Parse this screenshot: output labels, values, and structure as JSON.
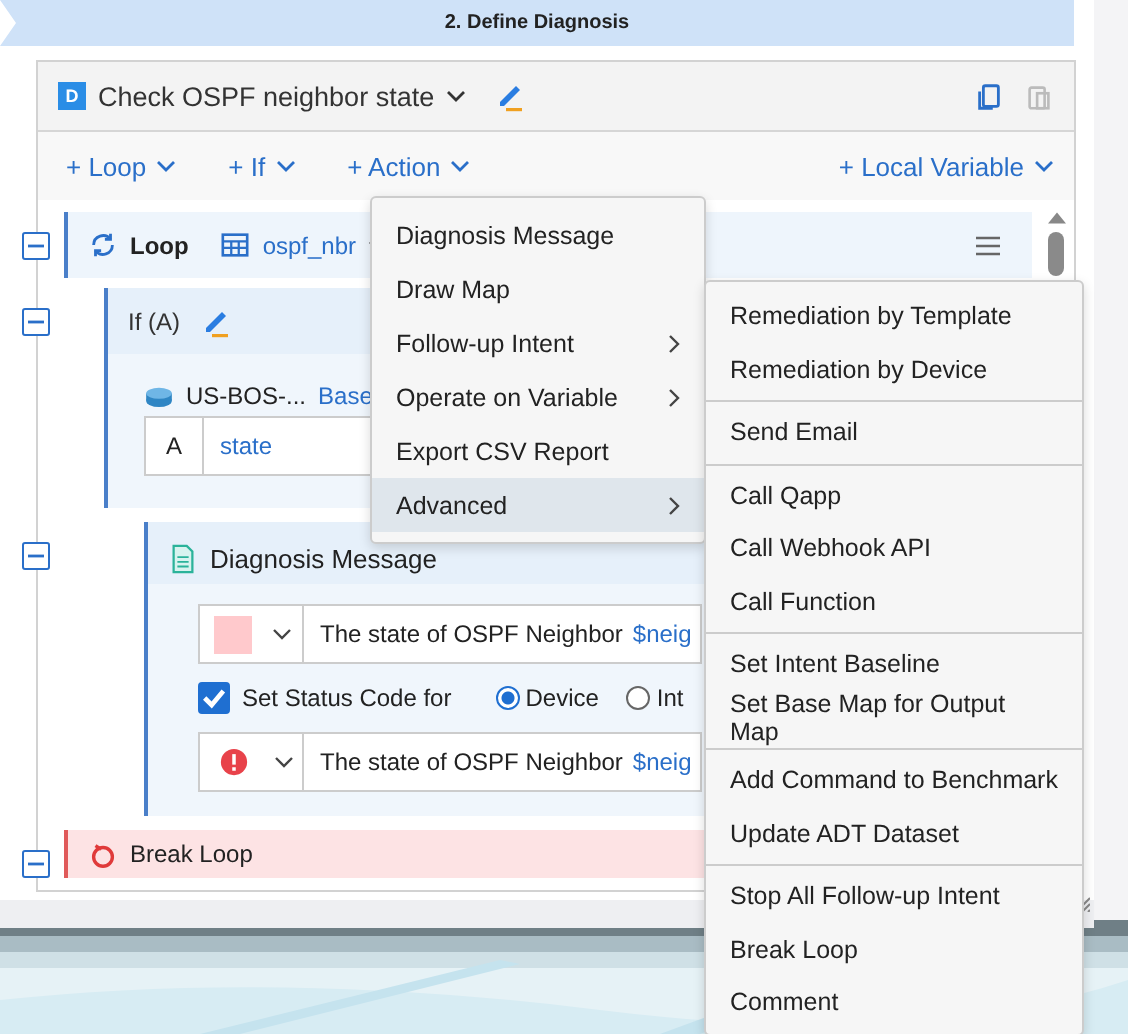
{
  "banner": {
    "title": "2. Define Diagnosis"
  },
  "panel": {
    "badge": "D",
    "title": "Check OSPF neighbor state"
  },
  "toolbar": {
    "left": [
      "+ Loop",
      "+ If",
      "+ Action"
    ],
    "right": "+ Local Variable"
  },
  "loop": {
    "expanded": true,
    "label": "Loop",
    "table": "ospf_nbr"
  },
  "if_block": {
    "expanded": true,
    "label": "If (A)",
    "device": "US-BOS-...",
    "device_link": "Base",
    "rows": [
      {
        "key": "A",
        "value": "state"
      }
    ]
  },
  "diagnosis": {
    "expanded": true,
    "title": "Diagnosis Message",
    "messages": [
      {
        "kind": "swatch",
        "text": "The state of OSPF Neighbor",
        "variable": "$neig"
      },
      {
        "kind": "error",
        "text": "The state of OSPF Neighbor",
        "variable": "$neig"
      }
    ],
    "status": {
      "checked": true,
      "label": "Set Status Code for",
      "options": [
        {
          "label": "Device",
          "selected": true
        },
        {
          "label": "Int",
          "selected": false
        }
      ]
    }
  },
  "break_loop": {
    "expanded": true,
    "label": "Break Loop"
  },
  "action_menu": {
    "items": [
      {
        "label": "Diagnosis Message",
        "submenu": false,
        "selected": false
      },
      {
        "label": "Draw Map",
        "submenu": false,
        "selected": false
      },
      {
        "label": "Follow-up Intent",
        "submenu": true,
        "selected": false
      },
      {
        "label": "Operate on Variable",
        "submenu": true,
        "selected": false
      },
      {
        "label": "Export CSV Report",
        "submenu": false,
        "selected": false
      },
      {
        "label": "Advanced",
        "submenu": true,
        "selected": true
      }
    ]
  },
  "advanced_menu": {
    "groups": [
      [
        "Remediation by Template",
        "Remediation by Device"
      ],
      [
        "Send Email"
      ],
      [
        "Call Qapp",
        "Call Webhook API",
        "Call Function"
      ],
      [
        "Set Intent Baseline",
        "Set Base Map for Output Map"
      ],
      [
        "Add Command to Benchmark",
        "Update ADT Dataset"
      ],
      [
        "Stop All Follow-up Intent",
        "Break Loop",
        "Comment"
      ]
    ]
  }
}
